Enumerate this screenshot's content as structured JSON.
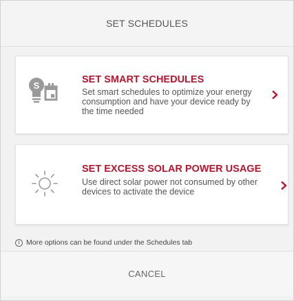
{
  "dialog": {
    "title": "SET SCHEDULES",
    "options": [
      {
        "title": "SET SMART SCHEDULES",
        "description": "Set smart schedules to optimize your energy consumption and have your device ready by the time needed",
        "icon": "smart-schedule-icon"
      },
      {
        "title": "SET EXCESS SOLAR POWER USAGE",
        "description": "Use direct solar power not consumed by other devices to activate the device",
        "icon": "sun-icon"
      }
    ],
    "info_text": "More options can be found under the Schedules tab",
    "cancel_label": "CANCEL"
  },
  "colors": {
    "accent": "#c0122a",
    "icon_gray": "#9a9a9a",
    "background": "#f2f2f2"
  }
}
